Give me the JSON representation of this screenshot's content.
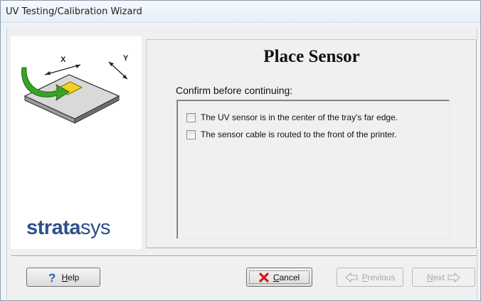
{
  "window": {
    "title": "UV Testing/Calibration Wizard"
  },
  "branding": {
    "logo_strong": "strata",
    "logo_light": "sys",
    "illustration_x_label": "X",
    "illustration_y_label": "Y"
  },
  "page": {
    "heading": "Place Sensor",
    "confirm_label": "Confirm before continuing:",
    "checklist": [
      {
        "label": "The UV sensor is in the center of the tray's far edge.",
        "checked": false
      },
      {
        "label": "The sensor cable is routed to the front of the printer.",
        "checked": false
      }
    ]
  },
  "buttons": {
    "help": {
      "label": "Help",
      "icon": "question-mark-icon"
    },
    "cancel": {
      "label": "Cancel",
      "icon": "red-x-icon"
    },
    "previous": {
      "label": "Previous",
      "icon": "left-arrow-icon",
      "enabled": false
    },
    "next": {
      "label": "Next",
      "icon": "right-arrow-icon",
      "enabled": false
    }
  },
  "colors": {
    "brand_blue": "#2e4f8c",
    "cancel_red": "#cc1a1a",
    "help_blue": "#1d5fbf",
    "arrow_green": "#3aa12a",
    "sensor_yellow": "#f2d321"
  }
}
